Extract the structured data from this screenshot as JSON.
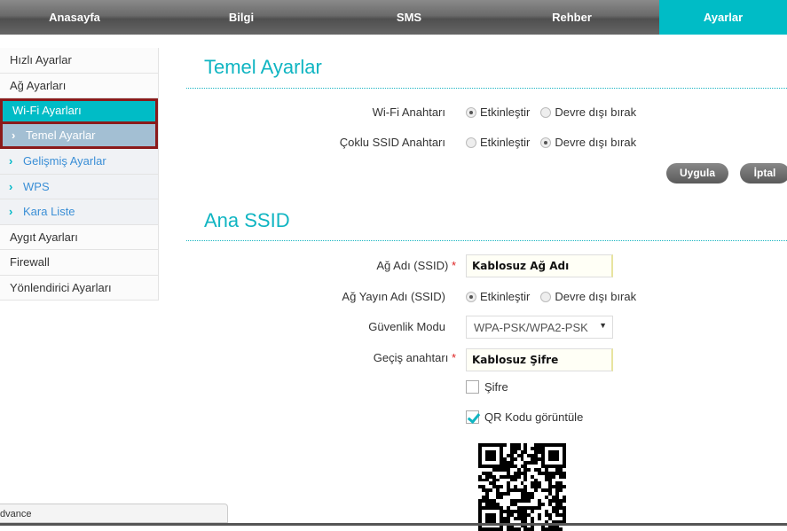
{
  "nav": {
    "tabs": [
      "Anasayfa",
      "Bilgi",
      "SMS",
      "Rehber",
      "Ayarlar"
    ],
    "active": "Ayarlar"
  },
  "sidebar": {
    "items": [
      "Hızlı Ayarlar",
      "Ağ Ayarları",
      "Wi-Fi Ayarları",
      "Temel Ayarlar",
      "Gelişmiş Ayarlar",
      "WPS",
      "Kara Liste",
      "Aygıt Ayarları",
      "Firewall",
      "Yönlendirici Ayarları"
    ]
  },
  "basic": {
    "title": "Temel Ayarlar",
    "wifi_switch": {
      "label": "Wi-Fi Anahtarı",
      "options": [
        "Etkinleştir",
        "Devre dışı bırak"
      ],
      "selected": "Etkinleştir"
    },
    "multi_ssid": {
      "label": "Çoklu SSID Anahtarı",
      "options": [
        "Etkinleştir",
        "Devre dışı bırak"
      ],
      "selected": "Devre dışı bırak"
    },
    "apply": "Uygula",
    "cancel": "İptal"
  },
  "ssid": {
    "title": "Ana SSID",
    "name_label": "Ağ Adı (SSID)",
    "name_value": "Kablosuz Ağ Adı",
    "required": "*",
    "broadcast": {
      "label": "Ağ Yayın Adı (SSID)",
      "options": [
        "Etkinleştir",
        "Devre dışı bırak"
      ],
      "selected": "Etkinleştir"
    },
    "security_label": "Güvenlik Modu",
    "security_value": "WPA-PSK/WPA2-PSK",
    "pass_label": "Geçiş anahtarı",
    "pass_value": "Kablosuz Şifre",
    "show_pass": {
      "label": "Şifre",
      "checked": false
    },
    "show_qr": {
      "label": "QR Kodu görüntüle",
      "checked": true
    }
  },
  "statusbar": {
    "text": "dvance"
  }
}
